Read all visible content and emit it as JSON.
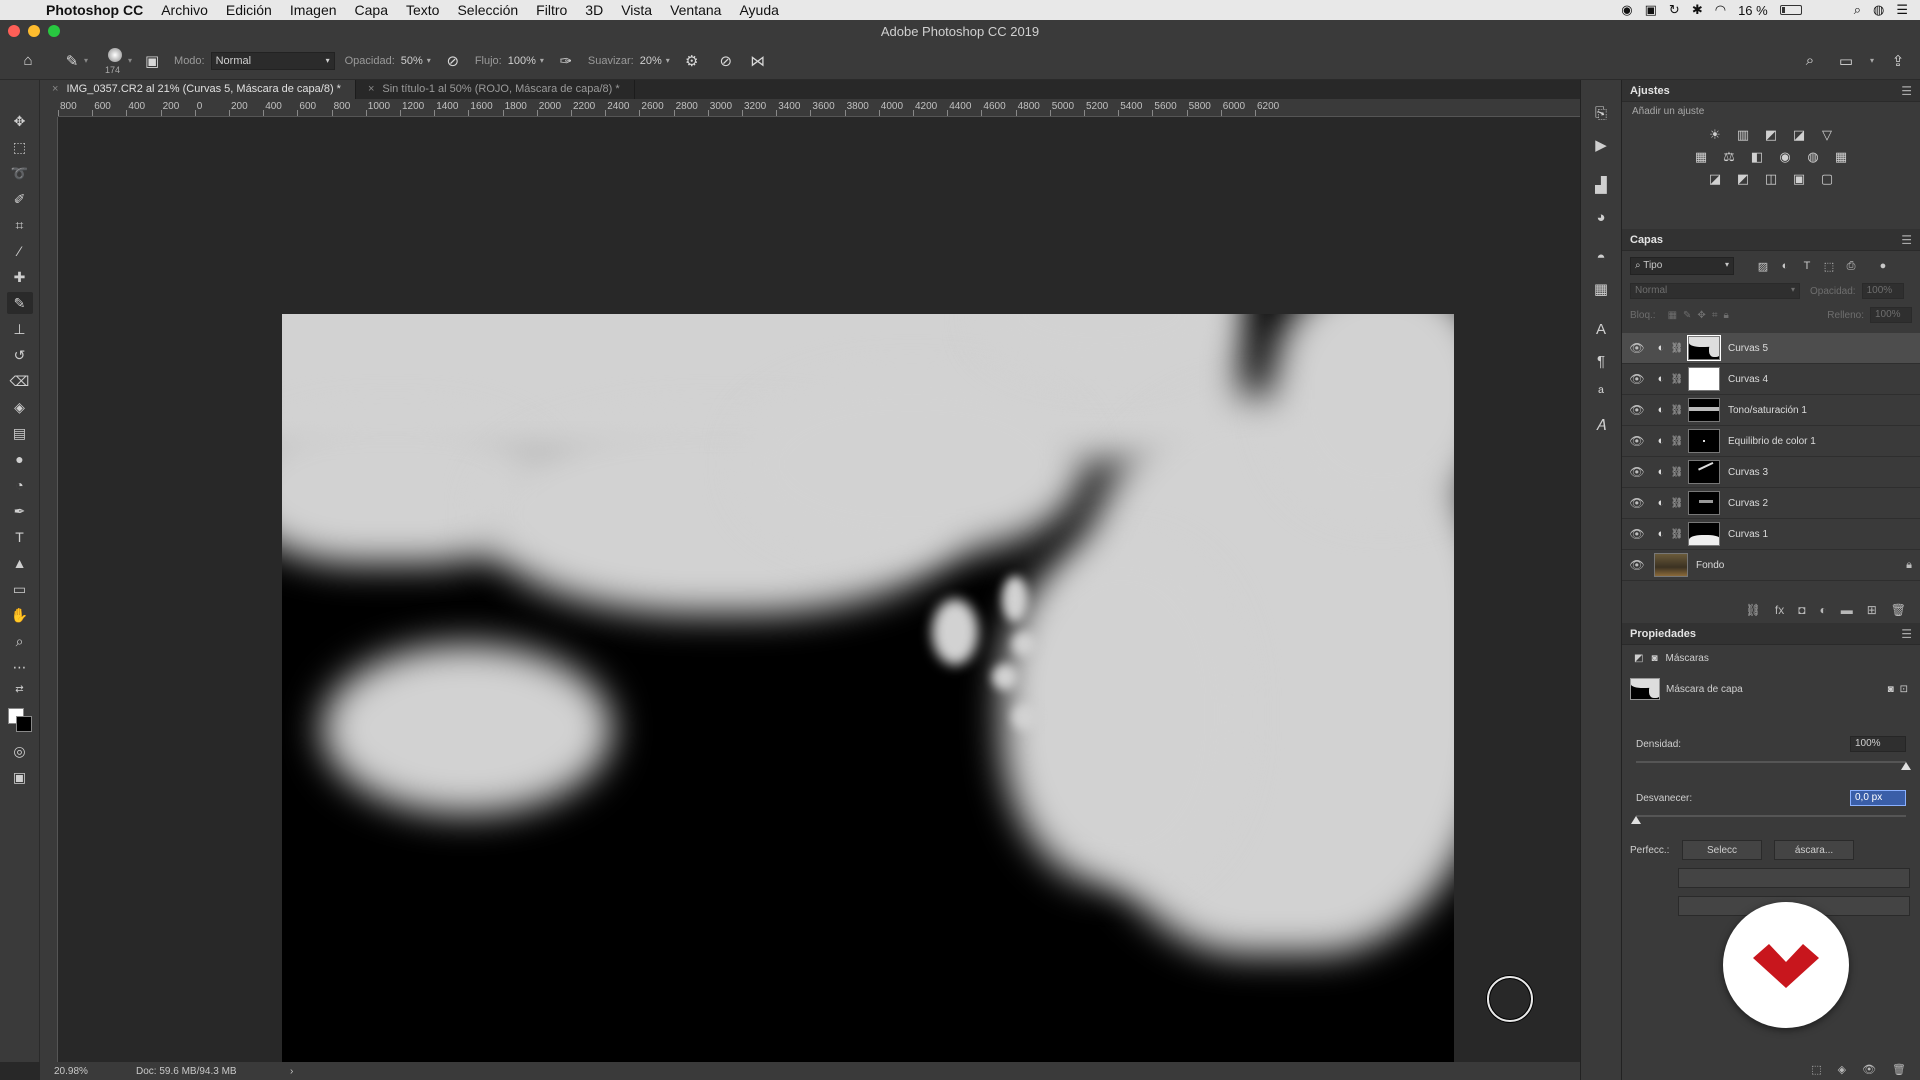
{
  "menubar": {
    "app_name": "Photoshop CC",
    "items": [
      "Archivo",
      "Edición",
      "Imagen",
      "Capa",
      "Texto",
      "Selección",
      "Filtro",
      "3D",
      "Vista",
      "Ventana",
      "Ayuda"
    ],
    "battery": "16 %"
  },
  "window": {
    "title": "Adobe Photoshop CC 2019"
  },
  "options": {
    "brush_size": "174",
    "mode_label": "Modo:",
    "mode_value": "Normal",
    "opacity_label": "Opacidad:",
    "opacity_value": "50%",
    "flow_label": "Flujo:",
    "flow_value": "100%",
    "smoothing_label": "Suavizar:",
    "smoothing_value": "20%"
  },
  "tabs": [
    {
      "label": "IMG_0357.CR2 al 21% (Curvas 5, Máscara de capa/8) *",
      "close": "×"
    },
    {
      "label": "Sin título-1 al 50% (ROJO, Máscara de capa/8) *",
      "close": "×"
    }
  ],
  "ruler": {
    "labels": [
      "800",
      "600",
      "400",
      "200",
      "0",
      "200",
      "400",
      "600",
      "800",
      "1000",
      "1200",
      "1400",
      "1600",
      "1800",
      "2000",
      "2200",
      "2400",
      "2600",
      "2800",
      "3000",
      "3200",
      "3400",
      "3600",
      "3800",
      "4000",
      "4200",
      "4400",
      "4600",
      "4800",
      "5000",
      "5200",
      "5400",
      "5600",
      "5800",
      "6000",
      "6200"
    ]
  },
  "status": {
    "zoom": "20.98%",
    "doc": "Doc: 59.6 MB/94.3 MB",
    "arrow": "›"
  },
  "adjustments": {
    "title": "Ajustes",
    "subtitle": "Añadir un ajuste",
    "row1": [
      "☀",
      "▥",
      "◩",
      "◪",
      "▽"
    ],
    "row2": [
      "▦",
      "⚖",
      "◧",
      "◉",
      "◍",
      "▦"
    ],
    "row3": [
      "◪",
      "◩",
      "◫",
      "▣",
      "▢"
    ]
  },
  "layers": {
    "title": "Capas",
    "filter": "Tipo",
    "blend_mode": "Normal",
    "opacity_label": "Opacidad:",
    "opacity_value": "100%",
    "lock_label": "Bloq.:",
    "fill_label": "Relleno:",
    "fill_value": "100%",
    "items": [
      {
        "name": "Curvas 5",
        "selected": true
      },
      {
        "name": "Curvas 4",
        "selected": false
      },
      {
        "name": "Tono/saturación 1",
        "selected": false
      },
      {
        "name": "Equilibrio de color 1",
        "selected": false
      },
      {
        "name": "Curvas 3",
        "selected": false
      },
      {
        "name": "Curvas 2",
        "selected": false
      },
      {
        "name": "Curvas 1",
        "selected": false
      },
      {
        "name": "Fondo",
        "selected": false
      }
    ]
  },
  "properties": {
    "title": "Propiedades",
    "tab_label": "Máscaras",
    "mask_label": "Máscara de capa",
    "density_label": "Densidad:",
    "density_value": "100%",
    "density_fraction": 1.0,
    "feather_label": "Desvanecer:",
    "feather_value": "0,0 px",
    "feather_fraction": 0.0,
    "refine_label": "Perfecc.:",
    "select_button": "Selecc",
    "mask_button": "áscara..."
  },
  "colors": {
    "menubar_bg": "#e8e8e8",
    "panel_bg": "#3a3a3a",
    "canvas_bg": "#282828",
    "selection_highlight": "#3a5ea8",
    "logo_red": "#c8161d"
  }
}
